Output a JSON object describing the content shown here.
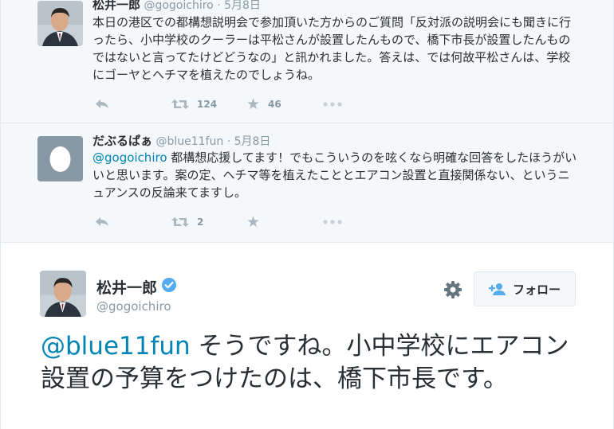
{
  "thread": {
    "tweet1": {
      "name": "松井一郎",
      "handle": "@gogoichiro",
      "separator": "·",
      "date": "5月8日",
      "text": "本日の港区での都構想説明会で参加頂いた方からのご質問「反対派の説明会にも聞きに行ったら、小中学校のクーラーは平松さんが設置したんもので、橋下市長が設置したんものではないと言ってたけどどうなの」と訊かれました。答えは、では何故平松さんは、学校にゴーヤとヘチマを植えたのでしょうね。",
      "retweet_count": "124",
      "favorite_count": "46",
      "icons": {
        "reply": "reply-icon",
        "retweet": "retweet-icon",
        "favorite": "star-icon",
        "more": "more-icon"
      }
    },
    "tweet2": {
      "name": "だぶるぱぁ",
      "handle": "@blue11fun",
      "separator": "·",
      "date": "5月8日",
      "mention": "@gogoichiro",
      "text": " 都構想応援してます！でもこういうのを呟くなら明確な回答をしたほうがいいと思います。案の定、ヘチマ等を植えたこととエアコン設置と直接関係ない、というニュアンスの反論来てますし。",
      "retweet_count": "2",
      "favorite_count": ""
    }
  },
  "main_tweet": {
    "name": "松井一郎",
    "handle": "@gogoichiro",
    "follow_label": "フォロー",
    "mention": "@blue11fun",
    "text": " そうですね。小中学校にエアコン設置の予算をつけたのは、橋下市長です。"
  },
  "colors": {
    "link": "#0084b4",
    "text": "#292f33",
    "secondary": "#8899a6",
    "thread_bg": "#f5f8fa",
    "verified": "#55acee"
  }
}
